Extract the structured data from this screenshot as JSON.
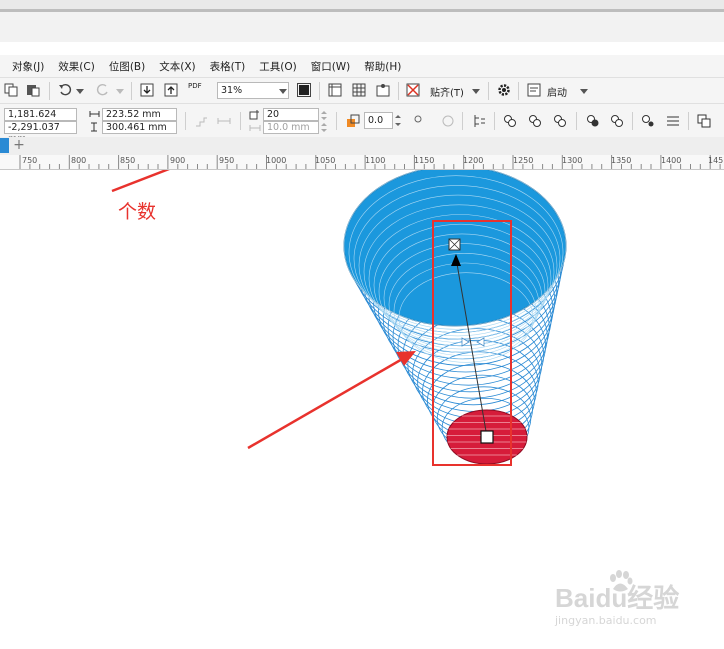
{
  "menu": {
    "items": [
      "对象(J)",
      "效果(C)",
      "位图(B)",
      "文本(X)",
      "表格(T)",
      "工具(O)",
      "窗口(W)",
      "帮助(H)"
    ]
  },
  "toolbar": {
    "pdf_label": "PDF",
    "zoom_value": "31%",
    "snap_label": "贴齐(T)",
    "launch_label": "启动"
  },
  "property_bar": {
    "pos_x": "1,181.624 mm",
    "pos_y": "-2,291.037 mm",
    "width": "223.52 mm",
    "height": "300.461 mm",
    "blend_steps": "20",
    "blend_spacing": "10.0 mm",
    "rotation": "0.0"
  },
  "ruler": {
    "ticks": [
      "750",
      "800",
      "850",
      "900",
      "950",
      "1000",
      "1050",
      "1100",
      "1150",
      "1200",
      "1250",
      "1300",
      "1350",
      "1400",
      "145"
    ]
  },
  "annotation": {
    "text": "个数"
  },
  "watermark": {
    "main": "Baidu经验",
    "sub": "jingyan.baidu.com"
  },
  "colors": {
    "annotation": "#e8322d",
    "cone_blue": "#1b98dd",
    "cone_red": "#d61c3a",
    "line_blue": "#2a8ad4"
  }
}
